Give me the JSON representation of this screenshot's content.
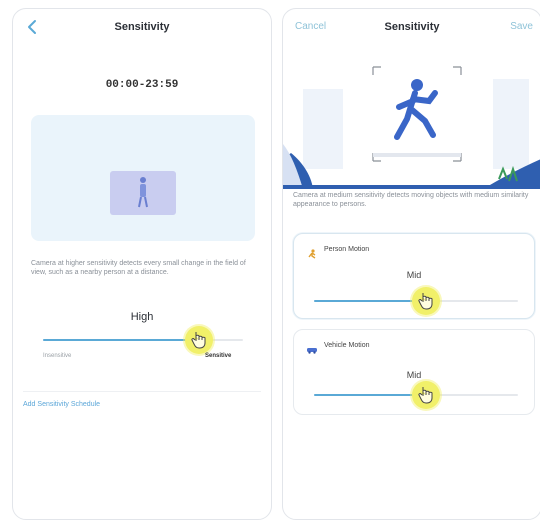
{
  "left_screen": {
    "header": {
      "title": "Sensitivity",
      "back_icon": "chevron-left-icon"
    },
    "time_range": "00:00-23:59",
    "description": "Camera at higher sensitivity detects every small change in the field of view, such as a nearby person at a distance.",
    "slider": {
      "level_label": "High",
      "value_fraction": 0.78,
      "min_label": "Insensitive",
      "max_label": "Sensitive"
    },
    "schedule_link": "Add Sensitivity Schedule"
  },
  "right_screen": {
    "header": {
      "title": "Sensitivity",
      "cancel_label": "Cancel",
      "save_label": "Save"
    },
    "description": "Camera at medium sensitivity detects moving objects with medium similarity appearance to persons.",
    "cards": [
      {
        "label": "Person Motion",
        "icon": "person-motion-icon",
        "level_label": "Mid",
        "value_fraction": 0.55
      },
      {
        "label": "Vehicle Motion",
        "icon": "vehicle-icon",
        "level_label": "Mid",
        "value_fraction": 0.55
      }
    ]
  },
  "colors": {
    "accent": "#5aa9d6",
    "touch_indicator": "#f1f069",
    "link": "#5ba6d8",
    "illustration_blue": "#2f5fb0"
  }
}
